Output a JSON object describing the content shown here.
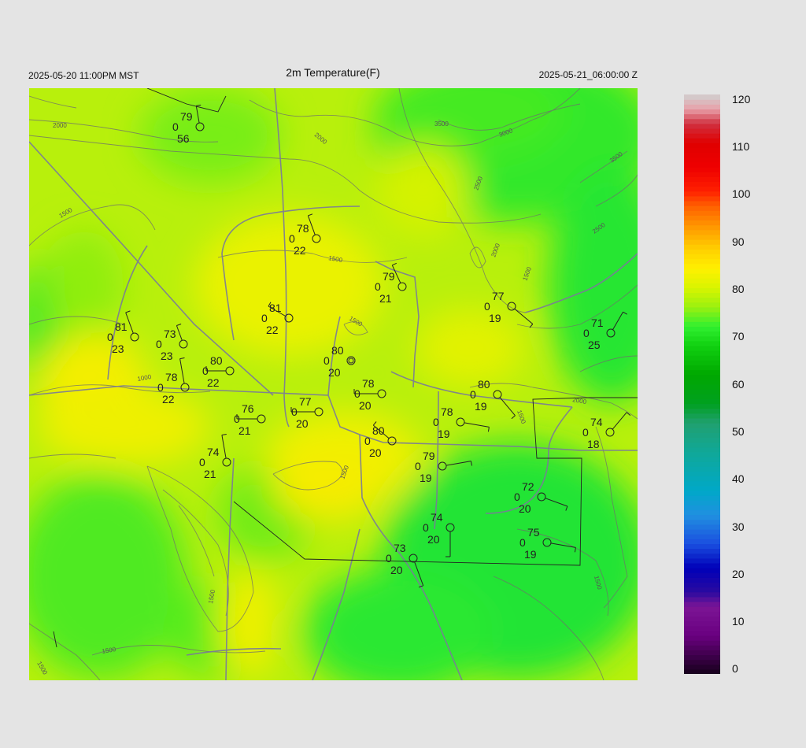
{
  "header": {
    "title": "2m Temperature(F)",
    "valid_local": "2025-05-20 11:00PM MST",
    "valid_utc": "2025-05-21_06:00:00 Z"
  },
  "colorbar": {
    "ticks": [
      "120",
      "110",
      "100",
      "90",
      "80",
      "70",
      "60",
      "50",
      "40",
      "30",
      "20",
      "10",
      "0"
    ],
    "range": [
      0,
      120
    ],
    "stops": [
      {
        "v": 0,
        "c": "#15001a"
      },
      {
        "v": 8,
        "c": "#6a0080"
      },
      {
        "v": 14,
        "c": "#7b1595"
      },
      {
        "v": 17,
        "c": "#2a0aa0"
      },
      {
        "v": 22,
        "c": "#0000b8"
      },
      {
        "v": 27,
        "c": "#1a4fe0"
      },
      {
        "v": 33,
        "c": "#2090e0"
      },
      {
        "v": 38,
        "c": "#00a8c8"
      },
      {
        "v": 46,
        "c": "#10a898"
      },
      {
        "v": 52,
        "c": "#20a070"
      },
      {
        "v": 56,
        "c": "#00a020"
      },
      {
        "v": 62,
        "c": "#00a800"
      },
      {
        "v": 68,
        "c": "#10d010"
      },
      {
        "v": 72,
        "c": "#30f030"
      },
      {
        "v": 76,
        "c": "#9af010"
      },
      {
        "v": 80,
        "c": "#d8f400"
      },
      {
        "v": 84,
        "c": "#fff000"
      },
      {
        "v": 88,
        "c": "#ffd000"
      },
      {
        "v": 92,
        "c": "#ffa000"
      },
      {
        "v": 97,
        "c": "#ff6000"
      },
      {
        "v": 100,
        "c": "#ff2000"
      },
      {
        "v": 105,
        "c": "#ee0000"
      },
      {
        "v": 110,
        "c": "#e00000"
      },
      {
        "v": 114,
        "c": "#d03040"
      },
      {
        "v": 117,
        "c": "#e8a0a8"
      },
      {
        "v": 120,
        "c": "#d0d0d0"
      }
    ]
  },
  "contour_labels": [
    "2000",
    "2000",
    "3500",
    "3000",
    "3500",
    "2500",
    "2500",
    "2000",
    "1500",
    "1500",
    "1500",
    "1500",
    "1000",
    "1500",
    "2000",
    "1500",
    "1500",
    "1500",
    "1500",
    "1500"
  ],
  "stations": [
    {
      "t": "79",
      "c": "0",
      "d": "56"
    },
    {
      "t": "78",
      "c": "0",
      "d": "22"
    },
    {
      "t": "79",
      "c": "0",
      "d": "21"
    },
    {
      "t": "77",
      "c": "0",
      "d": "19"
    },
    {
      "t": "71",
      "c": "0",
      "d": "25"
    },
    {
      "t": "81",
      "c": "0",
      "d": "23"
    },
    {
      "t": "73",
      "c": "0",
      "d": "23"
    },
    {
      "t": "81",
      "c": "0",
      "d": "22"
    },
    {
      "t": "80",
      "c": "0",
      "d": "20"
    },
    {
      "t": "80",
      "c": "0",
      "d": "22"
    },
    {
      "t": "78",
      "c": "0",
      "d": "22"
    },
    {
      "t": "78",
      "c": "0",
      "d": "20"
    },
    {
      "t": "80",
      "c": "0",
      "d": "19"
    },
    {
      "t": "77",
      "c": "0",
      "d": "20"
    },
    {
      "t": "76",
      "c": "0",
      "d": "21"
    },
    {
      "t": "78",
      "c": "0",
      "d": "19"
    },
    {
      "t": "74",
      "c": "0",
      "d": "18"
    },
    {
      "t": "80",
      "c": "0",
      "d": "20"
    },
    {
      "t": "74",
      "c": "0",
      "d": "21"
    },
    {
      "t": "79",
      "c": "0",
      "d": "19"
    },
    {
      "t": "72",
      "c": "0",
      "d": "20"
    },
    {
      "t": "74",
      "c": "0",
      "d": "20"
    },
    {
      "t": "75",
      "c": "0",
      "d": "19"
    },
    {
      "t": "73",
      "c": "0",
      "d": "20"
    }
  ]
}
